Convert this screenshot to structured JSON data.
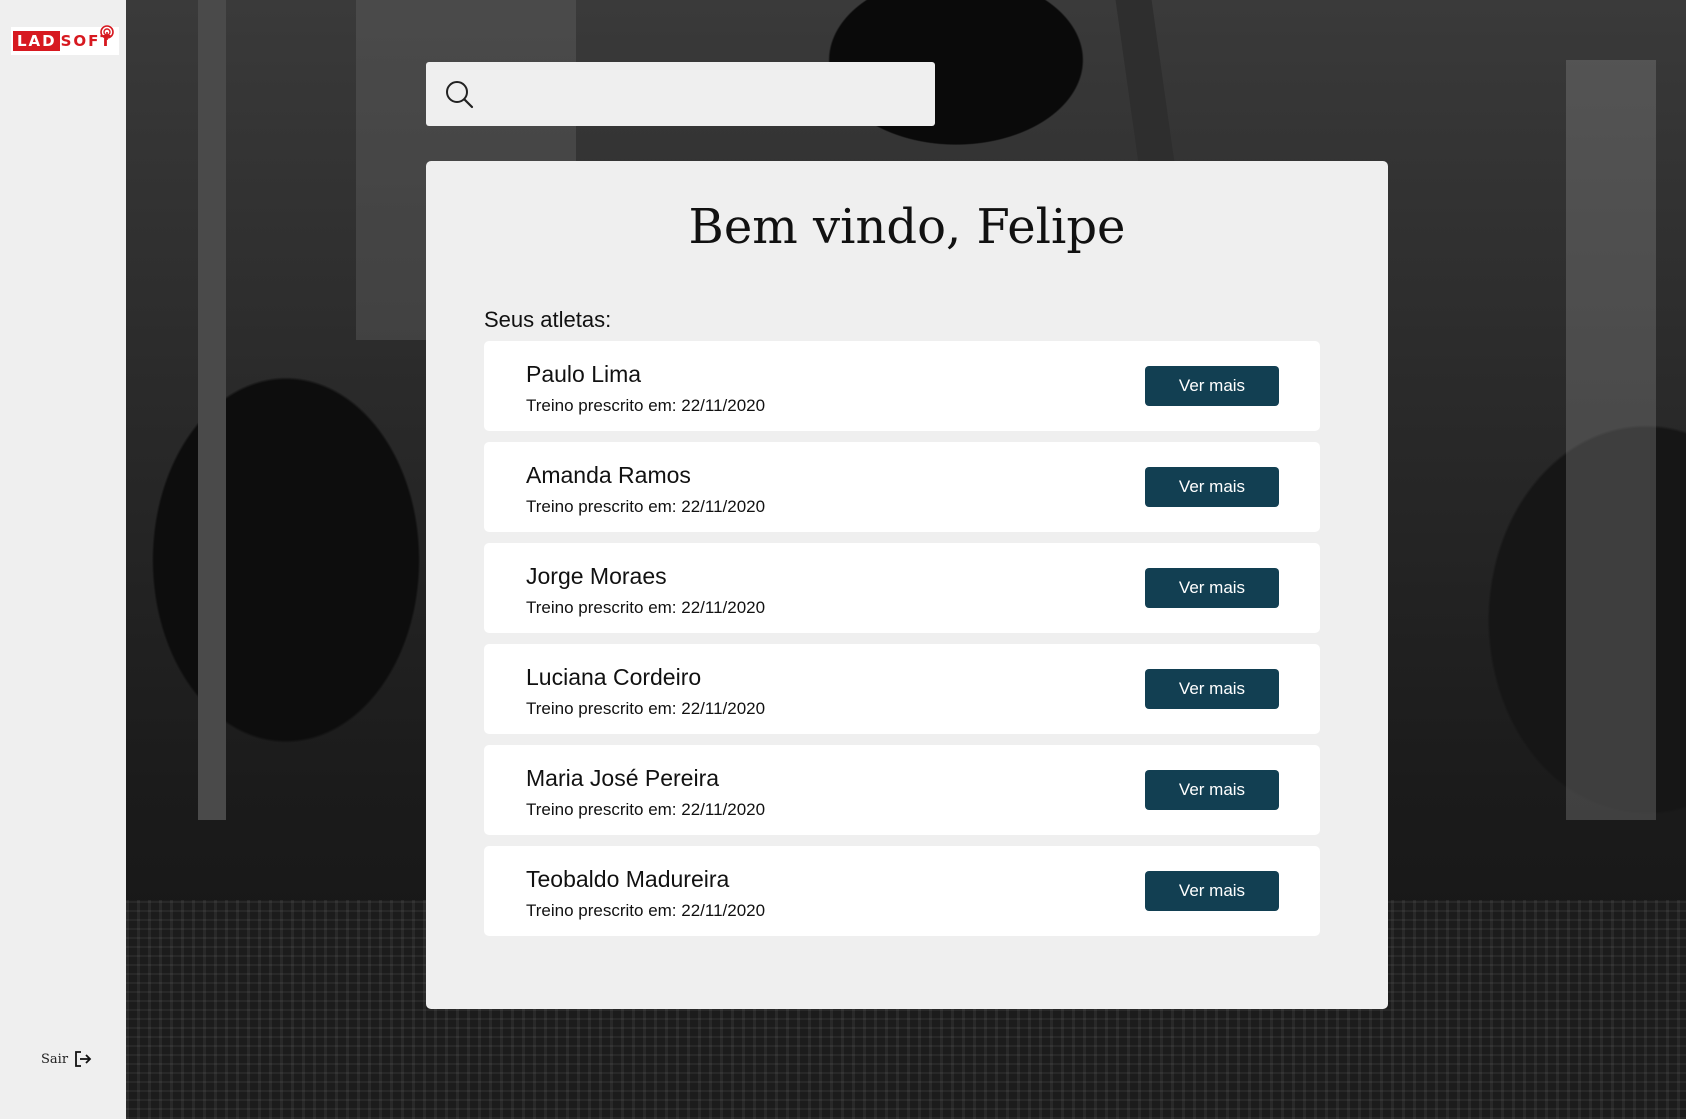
{
  "sidebar": {
    "logo": {
      "part1": "LAD",
      "part2": "SOFT"
    },
    "logout_label": "Sair"
  },
  "search": {
    "placeholder": ""
  },
  "main": {
    "title": "Bem vindo, Felipe",
    "athletes_label": "Seus atletas:",
    "athletes": [
      {
        "name": "Paulo Lima",
        "date": "Treino prescrito em: 22/11/2020",
        "action": "Ver mais"
      },
      {
        "name": "Amanda Ramos",
        "date": "Treino prescrito em: 22/11/2020",
        "action": "Ver mais"
      },
      {
        "name": "Jorge Moraes",
        "date": "Treino prescrito em: 22/11/2020",
        "action": "Ver mais"
      },
      {
        "name": "Luciana Cordeiro",
        "date": "Treino prescrito em: 22/11/2020",
        "action": "Ver mais"
      },
      {
        "name": "Maria José Pereira",
        "date": "Treino prescrito em: 22/11/2020",
        "action": "Ver mais"
      },
      {
        "name": "Teobaldo Madureira",
        "date": "Treino prescrito em: 22/11/2020",
        "action": "Ver mais"
      }
    ]
  },
  "colors": {
    "brand_red": "#d71920",
    "button": "#123f52",
    "panel": "#efefef"
  },
  "icons": [
    "search-icon",
    "logout-icon",
    "logo-mark-icon"
  ]
}
